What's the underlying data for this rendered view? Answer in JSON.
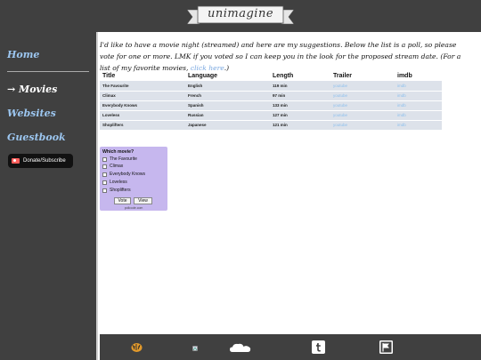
{
  "header": {
    "title": "unimagine"
  },
  "sidebar": {
    "items": [
      {
        "label": "Home",
        "active": false
      },
      {
        "label": "→ Movies",
        "active": true
      },
      {
        "label": "Websites",
        "active": false
      },
      {
        "label": "Guestbook",
        "active": false
      }
    ],
    "donate_label": "Donate/Subscribe"
  },
  "main": {
    "intro_text": "I'd like to have a movie night (streamed) and here are my suggestions. Below the list is a poll, so please vote for one or more. LMK if you voted so I can keep you in the look for the proposed stream date. (For a list of my favorite movies, ",
    "intro_link": "click here",
    "intro_end": ".)"
  },
  "table": {
    "headers": [
      "Title",
      "Language",
      "Length",
      "Trailer",
      "imdb"
    ],
    "rows": [
      [
        "The Favourite",
        "English",
        "119 min",
        "youtube",
        "imdb"
      ],
      [
        "Climax",
        "French",
        "97 min",
        "youtube",
        "imdb"
      ],
      [
        "Everybody Knows",
        "Spanish",
        "133 min",
        "youtube",
        "imdb"
      ],
      [
        "Loveless",
        "Russian",
        "127 min",
        "youtube",
        "imdb"
      ],
      [
        "Shoplifters",
        "Japanese",
        "121 min",
        "youtube",
        "imdb"
      ]
    ]
  },
  "poll": {
    "question": "Which movie?",
    "options": [
      "The Favourite",
      "Climax",
      "Everybody Knows",
      "Loveless",
      "Shoplifters"
    ],
    "vote_label": "Vote",
    "view_label": "View",
    "credit": "pollcode.com"
  },
  "footer": {
    "icons": [
      "tiger-icon",
      "broken-image-icon",
      "soundcloud-icon",
      "tumblr-icon",
      "flag-icon"
    ]
  },
  "colors": {
    "background_dark": "#404040",
    "nav_link": "#9cc6f0",
    "poll_bg": "#c6b7ee",
    "table_row": "#dde2ea"
  }
}
